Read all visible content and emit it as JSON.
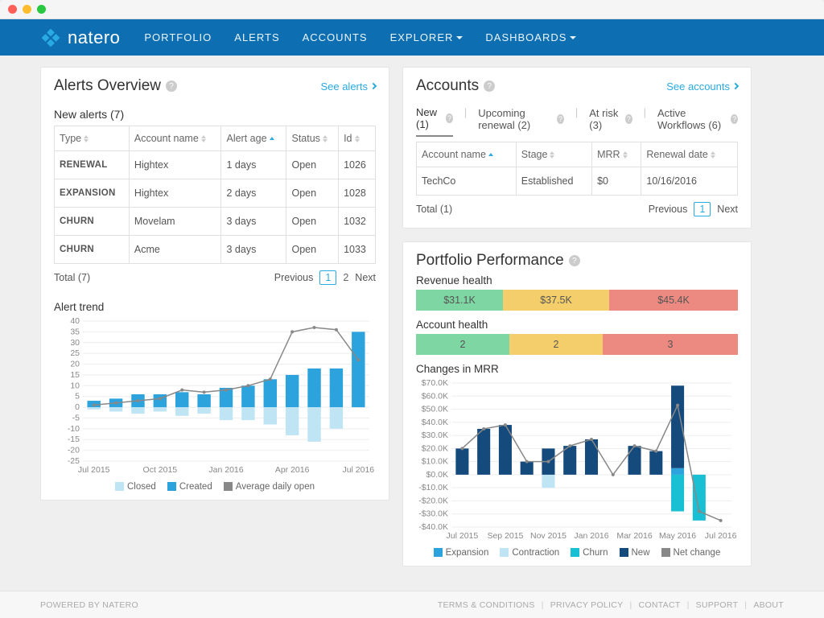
{
  "brand": "natero",
  "nav": {
    "portfolio": "PORTFOLIO",
    "alerts": "ALERTS",
    "accounts": "ACCOUNTS",
    "explorer": "EXPLORER",
    "dashboards": "DASHBOARDS"
  },
  "alerts_panel": {
    "title": "Alerts Overview",
    "see": "See alerts",
    "new_alerts_label": "New alerts (7)",
    "cols": {
      "type": "Type",
      "account": "Account name",
      "age": "Alert age",
      "status": "Status",
      "id": "Id"
    },
    "rows": [
      {
        "type": "RENEWAL",
        "account": "Hightex",
        "age": "1 days",
        "status": "Open",
        "id": "1026"
      },
      {
        "type": "EXPANSION",
        "account": "Hightex",
        "age": "2 days",
        "status": "Open",
        "id": "1028"
      },
      {
        "type": "CHURN",
        "account": "Movelam",
        "age": "3 days",
        "status": "Open",
        "id": "1032"
      },
      {
        "type": "CHURN",
        "account": "Acme",
        "age": "3 days",
        "status": "Open",
        "id": "1033"
      }
    ],
    "total": "Total (7)",
    "prev": "Previous",
    "p1": "1",
    "p2": "2",
    "next": "Next",
    "trend_title": "Alert trend",
    "legend": {
      "closed": "Closed",
      "created": "Created",
      "avg": "Average daily open"
    }
  },
  "accounts_panel": {
    "title": "Accounts",
    "see": "See accounts",
    "tabs": {
      "new": "New (1)",
      "upcoming": "Upcoming renewal (2)",
      "atrisk": "At risk (3)",
      "workflows": "Active Workflows (6)"
    },
    "cols": {
      "account": "Account name",
      "stage": "Stage",
      "mrr": "MRR",
      "renewal": "Renewal date"
    },
    "rows": [
      {
        "account": "TechCo",
        "stage": "Established",
        "mrr": "$0",
        "renewal": "10/16/2016"
      }
    ],
    "total": "Total (1)",
    "prev": "Previous",
    "p1": "1",
    "next": "Next"
  },
  "portfolio_panel": {
    "title": "Portfolio Performance",
    "rev_label": "Revenue health",
    "rev": {
      "green": "$31.1K",
      "yellow": "$37.5K",
      "red": "$45.4K"
    },
    "acct_label": "Account health",
    "acct": {
      "green": "2",
      "yellow": "2",
      "red": "3"
    },
    "mrr_title": "Changes in MRR",
    "legend": {
      "expansion": "Expansion",
      "contraction": "Contraction",
      "churn": "Churn",
      "new": "New",
      "net": "Net change"
    }
  },
  "footer": {
    "powered": "POWERED BY NATERO",
    "terms": "TERMS & CONDITIONS",
    "privacy": "PRIVACY POLICY",
    "contact": "CONTACT",
    "support": "SUPPORT",
    "about": "ABOUT"
  },
  "chart_data": [
    {
      "type": "bar",
      "title": "Alert trend",
      "categories": [
        "Jul 2015",
        "Aug 2015",
        "Sep 2015",
        "Oct 2015",
        "Nov 2015",
        "Dec 2015",
        "Jan 2016",
        "Feb 2016",
        "Mar 2016",
        "Apr 2016",
        "May 2016",
        "Jun 2016",
        "Jul 2016"
      ],
      "xticks_shown": [
        "Jul 2015",
        "Oct 2015",
        "Jan 2016",
        "Apr 2016",
        "Jul 2016"
      ],
      "series": [
        {
          "name": "Created",
          "color": "#2ca3dd",
          "values": [
            3,
            4,
            6,
            6,
            7,
            6,
            9,
            10,
            13,
            15,
            18,
            18,
            35
          ]
        },
        {
          "name": "Closed",
          "color": "#bfe4f4",
          "values": [
            -1,
            -2,
            -3,
            -2,
            -4,
            -3,
            -6,
            -6,
            -8,
            -13,
            -16,
            -10,
            0
          ]
        },
        {
          "name": "Average daily open",
          "type": "line",
          "color": "#888888",
          "values": [
            1,
            2,
            3,
            4,
            8,
            7,
            8,
            10,
            13,
            35,
            37,
            36,
            22
          ]
        }
      ],
      "ylim": [
        -25,
        40
      ],
      "yticks": [
        -25,
        -20,
        -15,
        -10,
        -5,
        0,
        5,
        10,
        15,
        20,
        25,
        30,
        35,
        40
      ]
    },
    {
      "type": "bar",
      "title": "Changes in MRR",
      "categories": [
        "Jul 2015",
        "Aug 2015",
        "Sep 2015",
        "Oct 2015",
        "Nov 2015",
        "Dec 2015",
        "Jan 2016",
        "Feb 2016",
        "Mar 2016",
        "Apr 2016",
        "May 2016",
        "Jun 2016",
        "Jul 2016"
      ],
      "xticks_shown": [
        "Jul 2015",
        "Sep 2015",
        "Nov 2015",
        "Jan 2016",
        "Mar 2016",
        "May 2016",
        "Jul 2016"
      ],
      "series": [
        {
          "name": "Expansion",
          "color": "#2ca3dd",
          "values": [
            0,
            0,
            0,
            0,
            0,
            0,
            0,
            0,
            0,
            0,
            5000,
            0,
            0
          ]
        },
        {
          "name": "Contraction",
          "color": "#bfe4f4",
          "values": [
            0,
            0,
            0,
            0,
            -10000,
            0,
            0,
            0,
            0,
            0,
            0,
            0,
            0
          ]
        },
        {
          "name": "Churn",
          "color": "#19bfd3",
          "values": [
            0,
            0,
            0,
            0,
            0,
            0,
            0,
            0,
            0,
            0,
            -28000,
            -35000,
            0
          ]
        },
        {
          "name": "New",
          "color": "#154a7d",
          "values": [
            20000,
            35000,
            38000,
            10000,
            20000,
            22000,
            27000,
            0,
            22000,
            18000,
            63000,
            0,
            0
          ]
        },
        {
          "name": "Net change",
          "type": "line",
          "color": "#888888",
          "values": [
            20000,
            35000,
            38000,
            10000,
            10000,
            22000,
            27000,
            0,
            22000,
            18000,
            53000,
            -28000,
            -35000
          ]
        }
      ],
      "ylim": [
        -40000,
        70000
      ],
      "yticks_labels": [
        "-$40.0K",
        "-$30.0K",
        "-$20.0K",
        "-$10.0K",
        "$0.0K",
        "$10.0K",
        "$20.0K",
        "$30.0K",
        "$40.0K",
        "$50.0K",
        "$60.0K",
        "$70.0K"
      ]
    }
  ]
}
